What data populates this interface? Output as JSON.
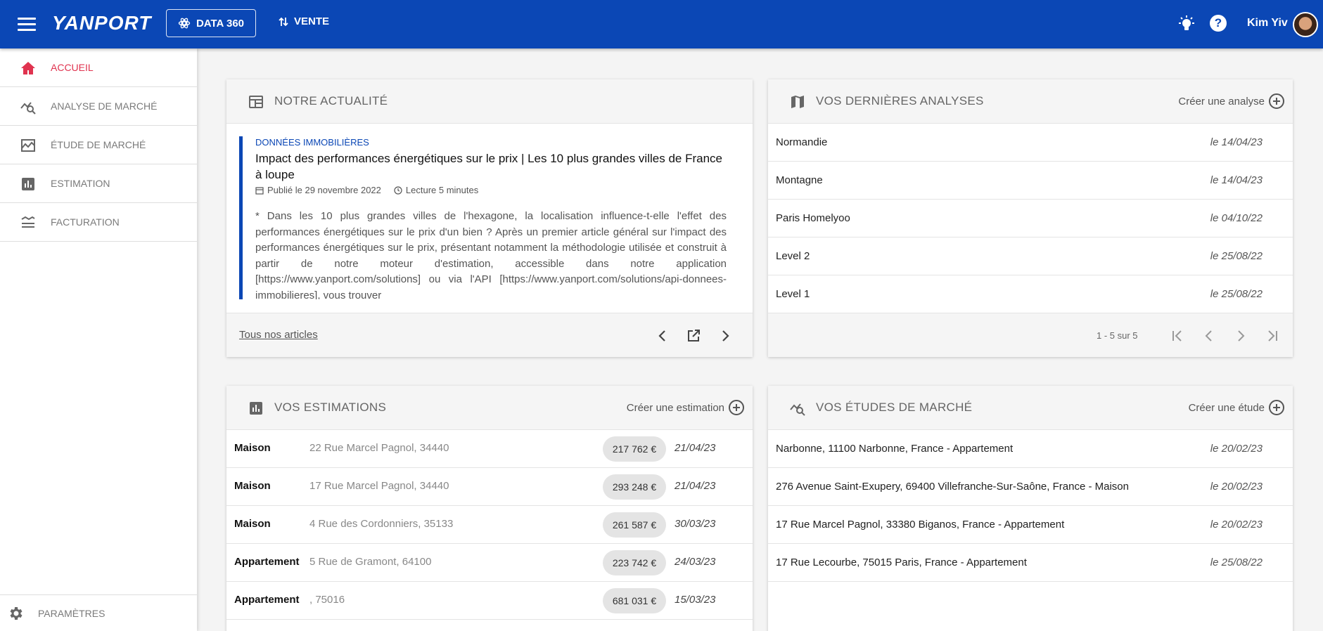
{
  "topbar": {
    "logo": "YANPORT",
    "data360_label": "DATA 360",
    "vente_label": "VENTE",
    "user_name": "Kim Yiv",
    "help_glyph": "?",
    "bg_color": "#0b47b5"
  },
  "sidebar": {
    "items": [
      {
        "label": "ACCUEIL",
        "icon": "home-icon",
        "active": true
      },
      {
        "label": "ANALYSE DE MARCHÉ",
        "icon": "market-analysis-icon"
      },
      {
        "label": "ÉTUDE DE MARCHÉ",
        "icon": "market-study-icon"
      },
      {
        "label": "ESTIMATION",
        "icon": "bar-chart-icon"
      },
      {
        "label": "FACTURATION",
        "icon": "billing-icon"
      }
    ],
    "settings_label": "PARAMÈTRES",
    "active_color": "#e0334f"
  },
  "news": {
    "title": "NOTRE ACTUALITÉ",
    "category": "DONNÉES IMMOBILIÈRES",
    "headline": "Impact des performances énergétiques sur le prix | Les 10 plus grandes villes de France à loupe",
    "published": "Publié le 29 novembre 2022",
    "reading_time": "Lecture 5 minutes",
    "excerpt": "* Dans les 10 plus grandes villes de l'hexagone, la localisation influence-t-elle l'effet des performances énergétiques sur le prix d'un bien ? Après un premier article général sur l'impact des performances énergétiques sur le prix, présentant notamment la méthodologie utilisée et construit à partir de notre moteur d'estimation, accessible dans notre application [https://www.yanport.com/solutions] ou via l'API [https://www.yanport.com/solutions/api-donnees-immobilieres], vous trouver",
    "all_articles": "Tous nos articles"
  },
  "analyses": {
    "title": "VOS DERNIÈRES ANALYSES",
    "action": "Créer une analyse",
    "rows": [
      {
        "name": "Normandie",
        "date": "le 14/04/23"
      },
      {
        "name": "Montagne",
        "date": "le 14/04/23"
      },
      {
        "name": "Paris Homelyoo",
        "date": "le 04/10/22"
      },
      {
        "name": "Level 2",
        "date": "le 25/08/22"
      },
      {
        "name": "Level 1",
        "date": "le 25/08/22"
      }
    ],
    "pagination": "1 - 5 sur 5"
  },
  "estimations": {
    "title": "VOS ESTIMATIONS",
    "action": "Créer une estimation",
    "rows": [
      {
        "type": "Maison",
        "address": "22 Rue Marcel Pagnol, 34440",
        "price": "217 762 €",
        "date": "21/04/23"
      },
      {
        "type": "Maison",
        "address": "17 Rue Marcel Pagnol, 34440",
        "price": "293 248 €",
        "date": "21/04/23"
      },
      {
        "type": "Maison",
        "address": "4 Rue des Cordonniers, 35133",
        "price": "261 587 €",
        "date": "30/03/23"
      },
      {
        "type": "Appartement",
        "address": "5 Rue de Gramont, 64100",
        "price": "223 742 €",
        "date": "24/03/23"
      },
      {
        "type": "Appartement",
        "address": ", 75016",
        "price": "681 031 €",
        "date": "15/03/23"
      }
    ]
  },
  "studies": {
    "title": "VOS ÉTUDES DE MARCHÉ",
    "action": "Créer une étude",
    "rows": [
      {
        "name": "Narbonne, 11100 Narbonne, France - Appartement",
        "date": "le 20/02/23"
      },
      {
        "name": "276 Avenue Saint-Exupery, 69400 Villefranche-Sur-Saône, France - Maison",
        "date": "le 20/02/23"
      },
      {
        "name": "17 Rue Marcel Pagnol, 33380 Biganos, France - Appartement",
        "date": "le 20/02/23"
      },
      {
        "name": "17 Rue Lecourbe, 75015 Paris, France - Appartement",
        "date": "le 25/08/22"
      }
    ]
  }
}
